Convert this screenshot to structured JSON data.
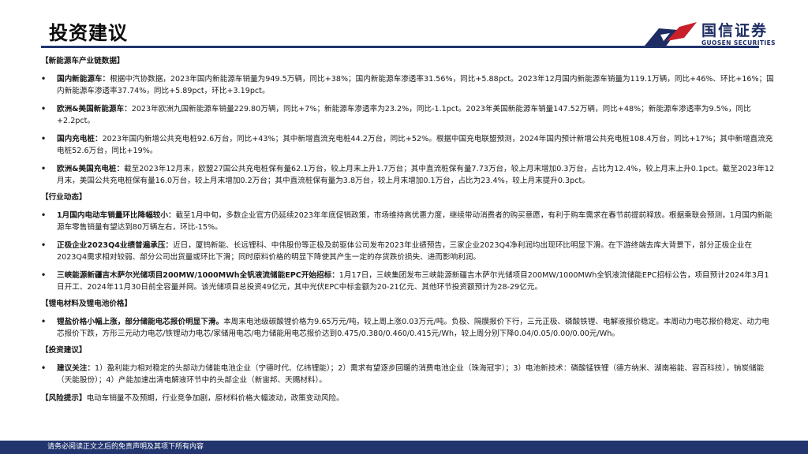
{
  "header": {
    "title": "投资建议",
    "logo": {
      "name_cn": "国信证券",
      "name_en": "GUOSEN SECURITIES"
    }
  },
  "sections": [
    {
      "heading": "【新能源车产业链数据】",
      "items": [
        {
          "lead": "国内新能源车：",
          "text": "根据中汽协数据，2023年国内新能源车销量为949.5万辆，同比+38%；国内新能源车渗透率31.56%，同比+5.88pct。2023年12月国内新能源车销量为119.1万辆，同比+46%、环比+16%；国内新能源车渗透率37.74%，同比+5.89pct，环比+3.19pct。"
        },
        {
          "lead": "欧洲&美国新能源车：",
          "text": "2023年欧洲九国新能源车销量229.80万辆，同比+7%；新能源车渗透率为23.2%，同比-1.1pct。2023年美国新能源车销量147.52万辆，同比+48%；新能源车渗透率为9.5%，同比+2.2pct。"
        },
        {
          "lead": "国内充电桩：",
          "text": "2023年国内新增公共充电桩92.6万台，同比+43%；其中新增直流充电桩44.2万台，同比+52%。根据中国充电联盟预测，2024年国内预计新增公共充电桩108.4万台，同比+17%；其中新增直流充电桩52.6万台，同比+19%。"
        },
        {
          "lead": "欧洲&美国充电桩：",
          "text": "截至2023年12月末，欧盟27国公共充电桩保有量62.1万台，较上月末上升1.7万台；其中直流桩保有量7.73万台，较上月末增加0.3万台，占比为12.4%，较上月末上升0.1pct。截至2023年12月末，美国公共充电桩保有量16.0万台，较上月末增加0.2万台；其中直流桩保有量为3.8万台，较上月末增加0.1万台，占比为23.4%，较上月末提升0.3pct。"
        }
      ]
    },
    {
      "heading": "【行业动态】",
      "items": [
        {
          "lead": "1月国内电动车销量环比降幅较小：",
          "text": "截至1月中旬，多数企业官方仍延续2023年年底促销政策，市场维持高优惠力度，继续带动消费者的购买意愿，有利于购车需求在春节前提前释放。根据乘联会预测，1月国内新能源车零售销量有望达到80万辆左右，环比-15%。"
        },
        {
          "lead": "正极企业2023Q4业绩普遍承压：",
          "text": "近日，厦钨新能、长远锂科、中伟股份等正极及前驱体公司发布2023年业绩预告，三家企业2023Q4净利润均出现环比明显下滑。在下游终端去库大背景下，部分正极企业在2023Q4需求相对较弱、部分公司出货量或环比下滑；同时原料价格的明显下降使其产生一定的存货跌价损失、进而影响利润。"
        },
        {
          "lead": "三峡能源新疆吉木萨尔光储项目200MW/1000MWh全钒液流储能EPC开始招标：",
          "text": "1月17日，三峡集团发布三峡能源新疆吉木萨尔光储项目200MW/1000MWh全钒液流储能EPC招标公告，项目预计2024年3月1日开工、2024年11月30日前全容量并网。该光储项目总投资49亿元，其中光伏EPC中标金额为20-21亿元、其他环节投资额预计为28-29亿元。"
        }
      ]
    },
    {
      "heading": "【锂电材料及锂电池价格】",
      "items": [
        {
          "lead": "锂盐价格小幅上涨，部分储能电芯报价明显下滑。",
          "text": "本周末电池级碳酸锂价格为9.65万元/吨，较上周上涨0.03万元/吨。负极、隔膜报价下行，三元正极、磷酸铁锂、电解液报价稳定。本周动力电芯报价稳定、动力电芯报价下跌，方形三元动力电芯/铁锂动力电芯/家储用电芯/电力储能用电芯报价达到0.475/0.380/0.460/0.415元/Wh，较上周分别下降0.04/0.05/0.00/0.00元/Wh。"
        }
      ]
    },
    {
      "heading": "【投资建议】",
      "items": [
        {
          "lead": "建议关注：",
          "text": "1）盈利能力相对稳定的头部动力储能电池企业（宁德时代、亿纬锂能）；2）需求有望逐步回暖的消费电池企业（珠海冠宇）；3）电池新技术：磷酸锰铁锂（德方纳米、湖南裕能、容百科技），钠炭储能（天能股份）；4）产能加速出清电解液环节中的头部企业（新宙邦、天赐材料）。"
        }
      ]
    }
  ],
  "risk": {
    "lead": "【风险提示】",
    "text": "电动车销量不及预期，行业竞争加剧，原材料价格大幅波动，政策变动风险。"
  },
  "footer": {
    "text": "请务必阅读正文之后的免责声明及其项下所有内容"
  },
  "colors": {
    "brand_navy": "#22356f",
    "brand_red": "#c8202a"
  },
  "bullet": "•"
}
